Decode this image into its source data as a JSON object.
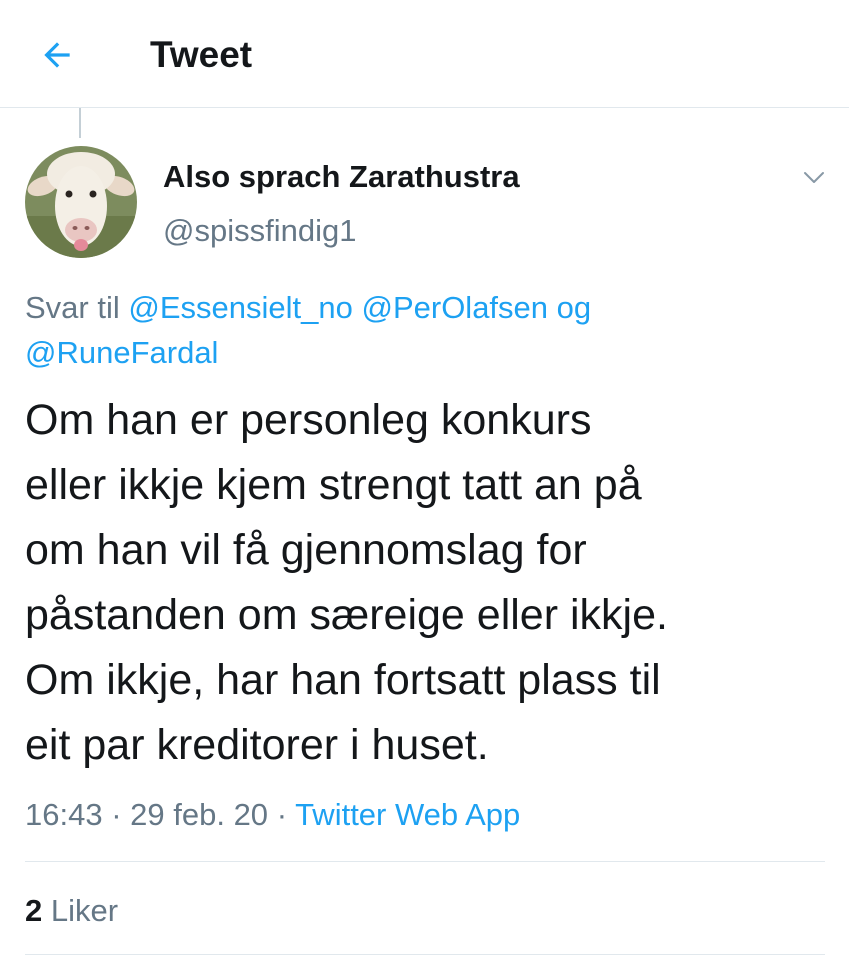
{
  "header": {
    "back_icon": "arrow-left-icon",
    "title": "Tweet",
    "accent_color": "#1da1f2"
  },
  "tweet": {
    "author": {
      "display_name": "Also sprach Zarathustra",
      "handle": "@spissfindig1",
      "avatar": "sheep-avatar"
    },
    "caret_icon": "chevron-down-icon",
    "reply_to": {
      "prefix": "Svar til",
      "mention_1": "@Essensielt_no",
      "mention_2": "@PerOlafsen",
      "conjunction": "og",
      "mention_3": "@RuneFardal"
    },
    "text": "Om han er personleg konkurs\neller ikkje kjem strengt tatt an på\nom han vil få gjennomslag for\npåstanden om særeige eller ikkje.\nOm ikkje, har han fortsatt plass til\neit par kreditorer i huset.",
    "time": "16:43",
    "separator": "·",
    "date": "29 feb. 20",
    "source": "Twitter Web App"
  },
  "stats": {
    "likes_count": "2",
    "likes_label": "Liker"
  }
}
